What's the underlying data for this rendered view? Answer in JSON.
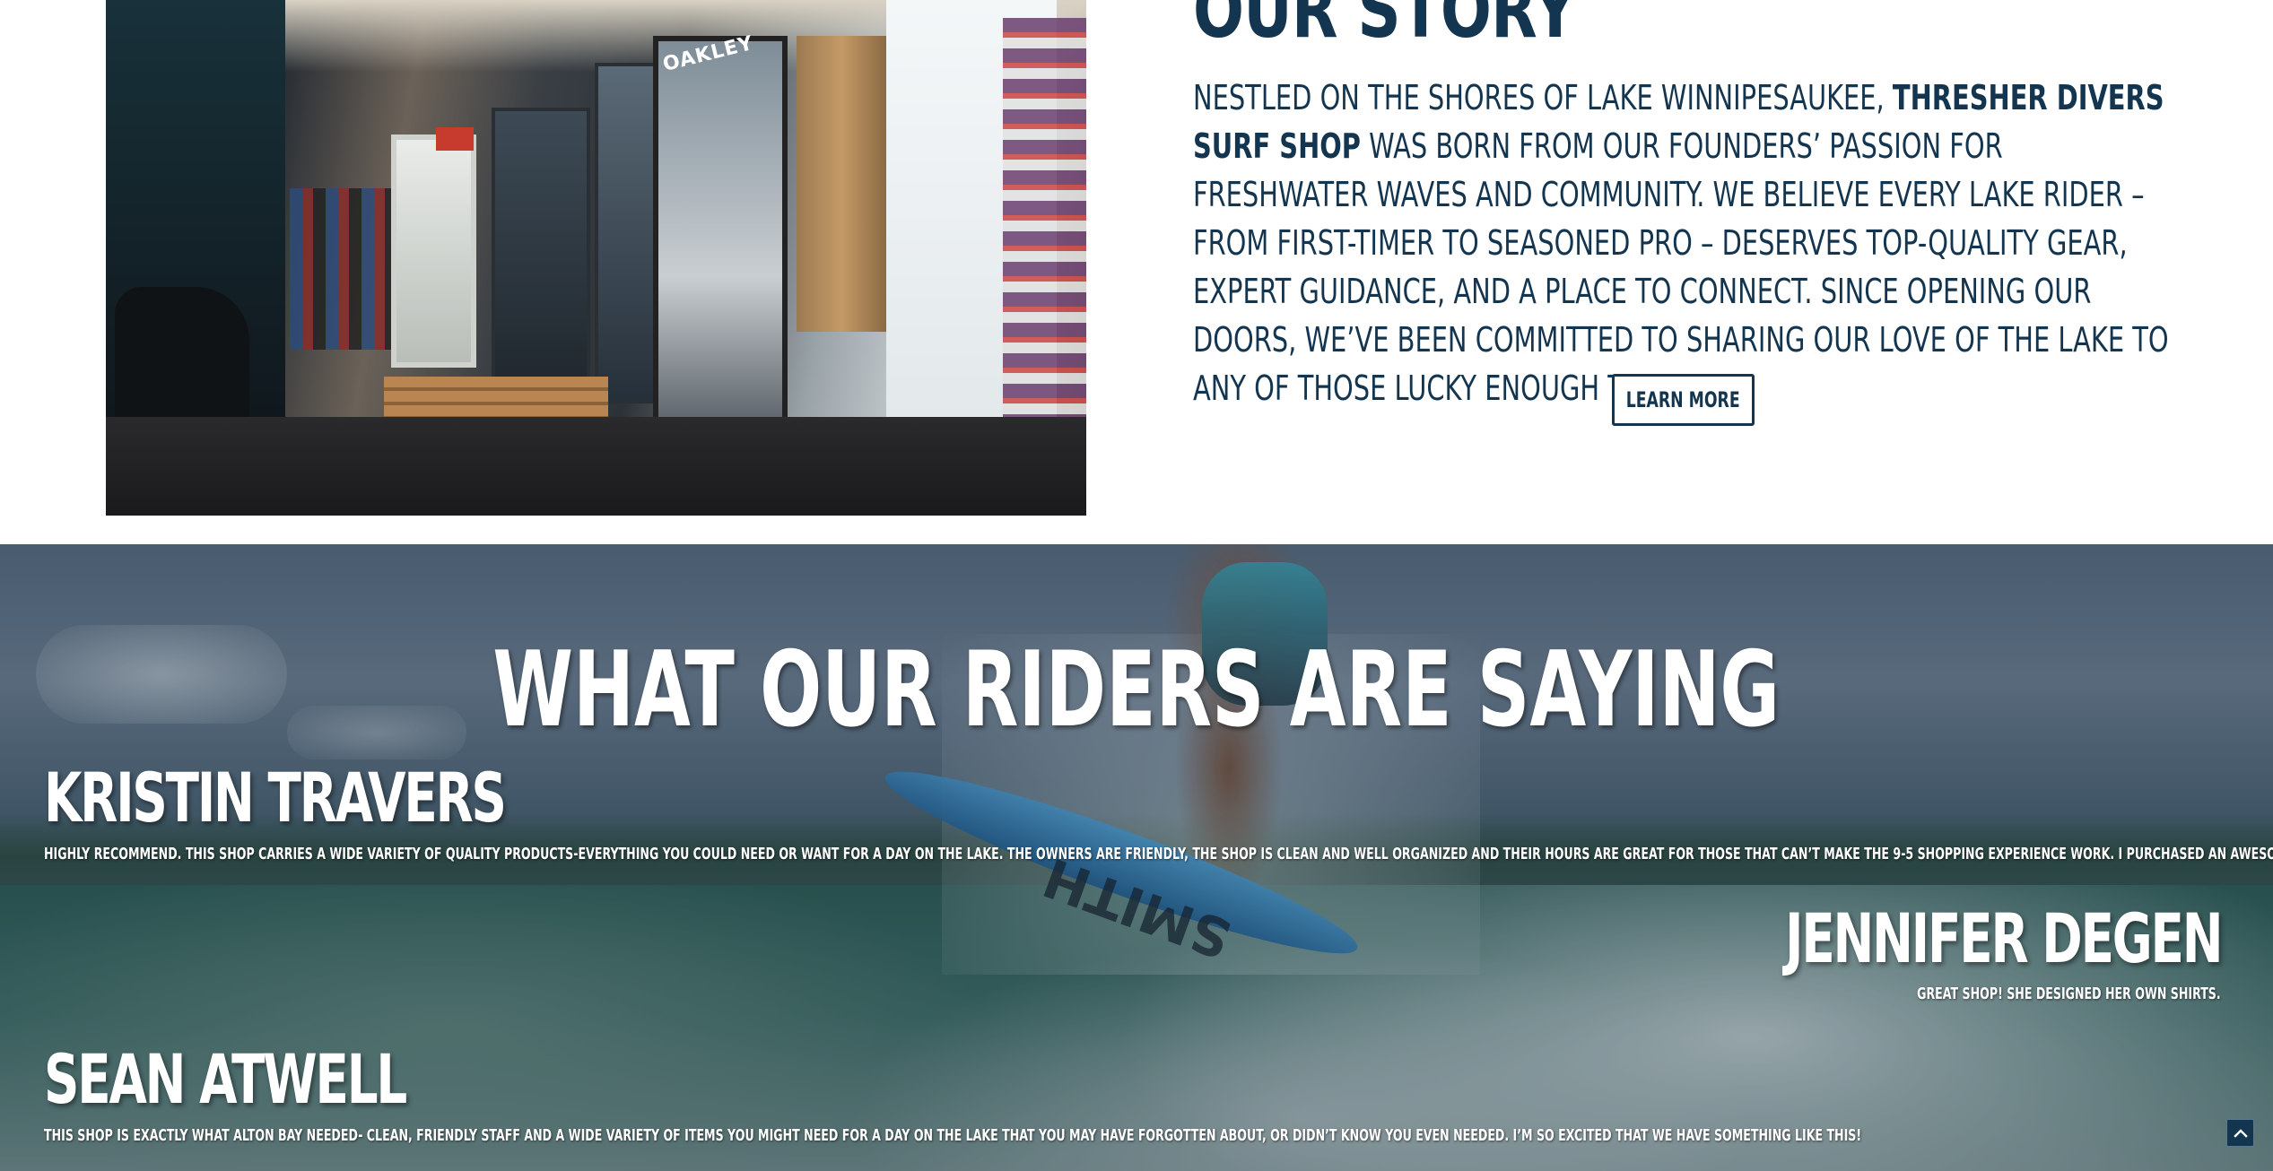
{
  "story": {
    "title": "OUR STORY",
    "paragraph_before": "Nestled on the shores of Lake Winnipesaukee, ",
    "shop_name": "Thresher Divers Surf Shop",
    "paragraph_after": " was born from our founders’ passion for freshwater waves and community. We believe every lake rider – from first-timer to seasoned pro – deserves top-quality gear, expert guidance, and a place to connect. Since opening our doors, we’ve been committed to sharing our love of the lake to any of those lucky enough to ride it.",
    "button_label": "LEARN MORE",
    "photo_sign_text": "OAKLEY"
  },
  "testimonials": {
    "heading_part1": "WHAT ",
    "heading_bold": "OUR",
    "heading_part2": " RIDERS ARE SAYING",
    "board_logo_text": "SMITH",
    "reviews": [
      {
        "name": "KRISTIN TRAVERS",
        "text": "Highly recommend. This shop carries a wide variety of quality products-everything you could need or want for a day on the lake. The owners are friendly, the shop is clean and well organized and their hours are great for those that can’t make the 9-5 shopping experience work. I purchased an awesome, original artwork shirt and I love the quality."
      },
      {
        "name": "JENNIFER DEGEN",
        "text": "Great shop! She designed her own shirts."
      },
      {
        "name": "SEAN ATWELL",
        "text": "This shop is exactly what Alton Bay needed- clean, friendly staff and a wide variety of items you might need for a day on the lake that you may have forgotten about, or didn’t know you even needed. I’m so excited that we have something like this!"
      }
    ]
  },
  "scroll_top": {
    "icon": "chevron-up-icon"
  },
  "colors": {
    "brand_navy": "#14354f",
    "white": "#ffffff"
  }
}
